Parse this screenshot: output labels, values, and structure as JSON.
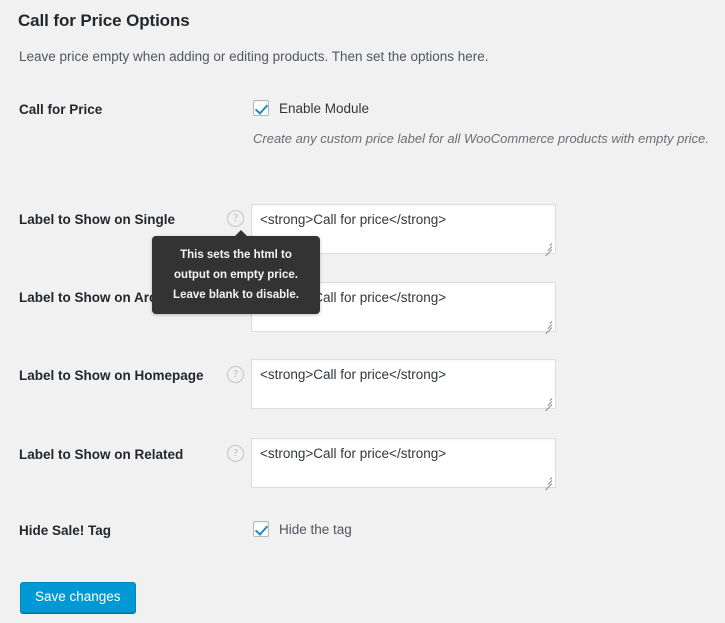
{
  "header": {
    "title": "Call for Price Options",
    "description": "Leave price empty when adding or editing products. Then set the options here."
  },
  "rows": {
    "call_for_price": {
      "label": "Call for Price",
      "checkbox_label": "Enable Module",
      "checkbox_checked": true,
      "field_description": "Create any custom price label for all WooCommerce products with empty price."
    },
    "single": {
      "label": "Label to Show on Single",
      "help_icon": "help-circle-icon",
      "value": "<strong>Call for price</strong>"
    },
    "archives": {
      "label": "Label to Show on Archives",
      "help_icon": "help-circle-icon",
      "value": "<strong>Call for price</strong>"
    },
    "homepage": {
      "label": "Label to Show on Homepage",
      "help_icon": "help-circle-icon",
      "value": "<strong>Call for price</strong>"
    },
    "related": {
      "label": "Label to Show on Related",
      "help_icon": "help-circle-icon",
      "value": "<strong>Call for price</strong>"
    },
    "hide_sale_tag": {
      "label": "Hide Sale! Tag",
      "checkbox_label": "Hide the tag",
      "checkbox_checked": true
    }
  },
  "tooltip": {
    "text": "This sets the html to output on empty price. Leave blank to disable."
  },
  "footer": {
    "save_label": "Save changes"
  },
  "colors": {
    "page_background": "#f1f1f1",
    "accent_blue": "#0099d5",
    "checkbox_check": "#1e8cbe",
    "tooltip_background": "#333333",
    "heading_text": "#23282d"
  },
  "icons": {
    "help": "?"
  }
}
